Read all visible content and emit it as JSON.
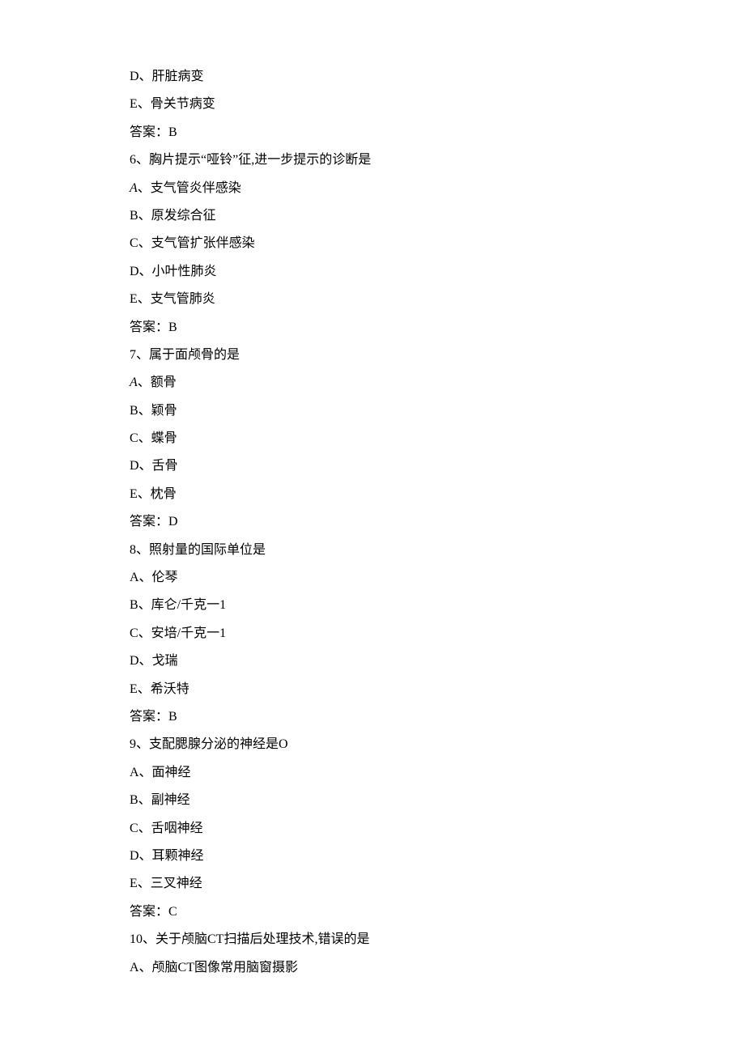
{
  "lines": {
    "l01": "D、肝脏病变",
    "l02": "E、骨关节病变",
    "l03": "答案：B",
    "l04": "6、胸片提示“哑铃”征,进一步提示的诊断是",
    "l05a": "A",
    "l05b": "、支气管炎伴感染",
    "l06": "B、原发综合征",
    "l07": "C、支气管扩张伴感染",
    "l08": "D、小叶性肺炎",
    "l09": "E、支气管肺炎",
    "l10": "答案：B",
    "l11": "7、属于面颅骨的是",
    "l12a": "A",
    "l12b": "、额骨",
    "l13": "B、颖骨",
    "l14": "C、蝶骨",
    "l15": "D、舌骨",
    "l16": "E、枕骨",
    "l17": "答案：D",
    "l18": "8、照射量的国际单位是",
    "l19": "A、伦琴",
    "l20": "B、库仑/千克一1",
    "l21": "C、安培/千克一1",
    "l22": "D、戈瑞",
    "l23": "E、希沃特",
    "l24": "答案：B",
    "l25": "9、支配腮腺分泌的神经是O",
    "l26": "A、面神经",
    "l27": "B、副神经",
    "l28": "C、舌咽神经",
    "l29": "D、耳颗神经",
    "l30": "E、三叉神经",
    "l31": "答案：C",
    "l32": "10、关于颅脑CT扫描后处理技术,错误的是",
    "l33": "A、颅脑CT图像常用脑窗摄影"
  }
}
